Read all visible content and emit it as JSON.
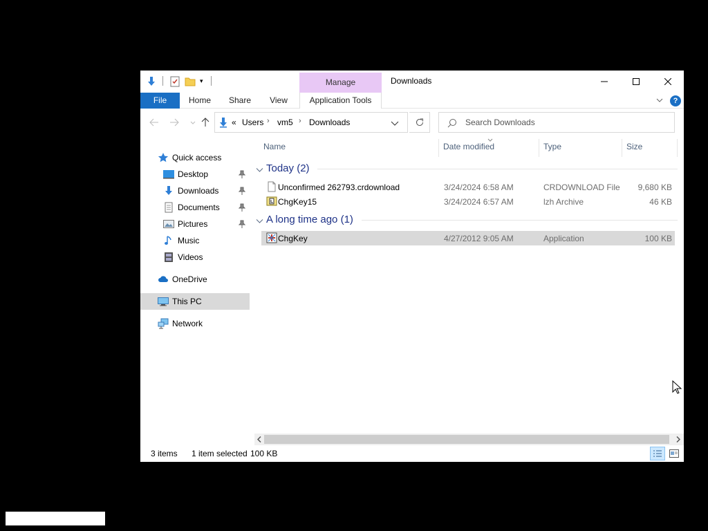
{
  "window": {
    "title": "Downloads",
    "context_tab_group": "Manage"
  },
  "quick_access_toolbar": {
    "customize_glyph": "▾"
  },
  "ribbon": {
    "tabs": [
      {
        "label": "File",
        "active": true
      },
      {
        "label": "Home"
      },
      {
        "label": "Share"
      },
      {
        "label": "View"
      },
      {
        "label": "Application Tools"
      }
    ],
    "help_glyph": "?"
  },
  "address_bar": {
    "overflow": "«",
    "breadcrumbs": [
      "Users",
      "vm5",
      "Downloads"
    ]
  },
  "search": {
    "placeholder": "Search Downloads"
  },
  "nav_pane": {
    "items": [
      {
        "label": "Quick access",
        "icon": "star-icon"
      },
      {
        "label": "Desktop",
        "icon": "desktop-icon",
        "pinned": true
      },
      {
        "label": "Downloads",
        "icon": "download-arrow-icon",
        "pinned": true
      },
      {
        "label": "Documents",
        "icon": "documents-icon",
        "pinned": true
      },
      {
        "label": "Pictures",
        "icon": "pictures-icon",
        "pinned": true
      },
      {
        "label": "Music",
        "icon": "music-icon"
      },
      {
        "label": "Videos",
        "icon": "videos-icon"
      },
      {
        "label": "OneDrive",
        "icon": "cloud-icon"
      },
      {
        "label": "This PC",
        "icon": "computer-icon",
        "selected": true
      },
      {
        "label": "Network",
        "icon": "network-icon"
      }
    ]
  },
  "columns": [
    "Name",
    "Date modified",
    "Type",
    "Size"
  ],
  "groups": [
    {
      "label": "Today (2)",
      "files": [
        {
          "name": "Unconfirmed 262793.crdownload",
          "date": "3/24/2024 6:58 AM",
          "type": "CRDOWNLOAD File",
          "size": "9,680 KB",
          "icon": "blank-file-icon"
        },
        {
          "name": "ChgKey15",
          "date": "3/24/2024 6:57 AM",
          "type": "lzh Archive",
          "size": "46 KB",
          "icon": "archive-icon"
        }
      ]
    },
    {
      "label": "A long time ago (1)",
      "files": [
        {
          "name": "ChgKey",
          "date": "4/27/2012 9:05 AM",
          "type": "Application",
          "size": "100 KB",
          "icon": "application-icon",
          "selected": true
        }
      ]
    }
  ],
  "status_bar": {
    "item_count": "3 items",
    "selection": "1 item selected",
    "selection_size": "100 KB"
  },
  "colors": {
    "file_tab": "#1a6fc4",
    "manage_context": "#e8c8f5",
    "group_header": "#1e3287",
    "selection": "#d9d9d9"
  }
}
